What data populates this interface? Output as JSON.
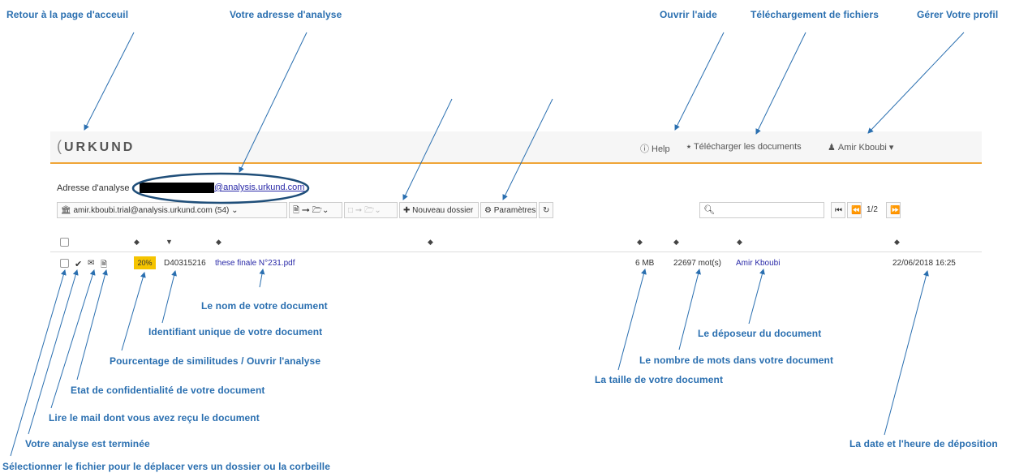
{
  "annotations": {
    "home": "Retour à la page d'acceuil",
    "address": "Votre adresse d'analyse",
    "help": "Ouvrir l'aide",
    "upload": "Téléchargement de fichiers",
    "profile": "Gérer Votre profil",
    "doc_name": "Le nom de votre document",
    "doc_id": "Identifiant unique de votre document",
    "similarity": "Pourcentage de similitudes / Ouvrir l'analyse",
    "confidentiality": "Etat de confidentialité de votre document",
    "mail": "Lire le mail dont vous avez reçu le document",
    "done": "Votre analyse est terminée",
    "select": "Sélectionner le fichier pour le déplacer vers un dossier ou la corbeille",
    "uploader": "Le déposeur du document",
    "word_count": "Le nombre de mots dans votre document",
    "size": "La taille de votre document",
    "datetime": "La date et l'heure de déposition"
  },
  "app": {
    "logo": "URKUND",
    "nav": {
      "help": "Help",
      "upload": "Télécharger les documents",
      "user": "Amir Kboubi"
    },
    "address_label": "Adresse d'analyse :",
    "address_domain": "@analysis.urkund.com",
    "toolbar": {
      "mailbox": "amir.kboubi.trial@analysis.urkund.com (54)",
      "new_folder": "Nouveau dossier",
      "settings": "Paramètres",
      "search_placeholder": "",
      "page": "1/2"
    },
    "row": {
      "similarity": "20%",
      "id": "D40315216",
      "name": "these finale N°231.pdf",
      "size": "6 MB",
      "words": "22697 mot(s)",
      "uploader": "Amir Kboubi",
      "date": "22/06/2018 16:25"
    }
  },
  "colors": {
    "annotation": "#2a6fb0",
    "accent_bar": "#f0a537",
    "badge": "#f5c400",
    "link": "#2a2aa8"
  }
}
